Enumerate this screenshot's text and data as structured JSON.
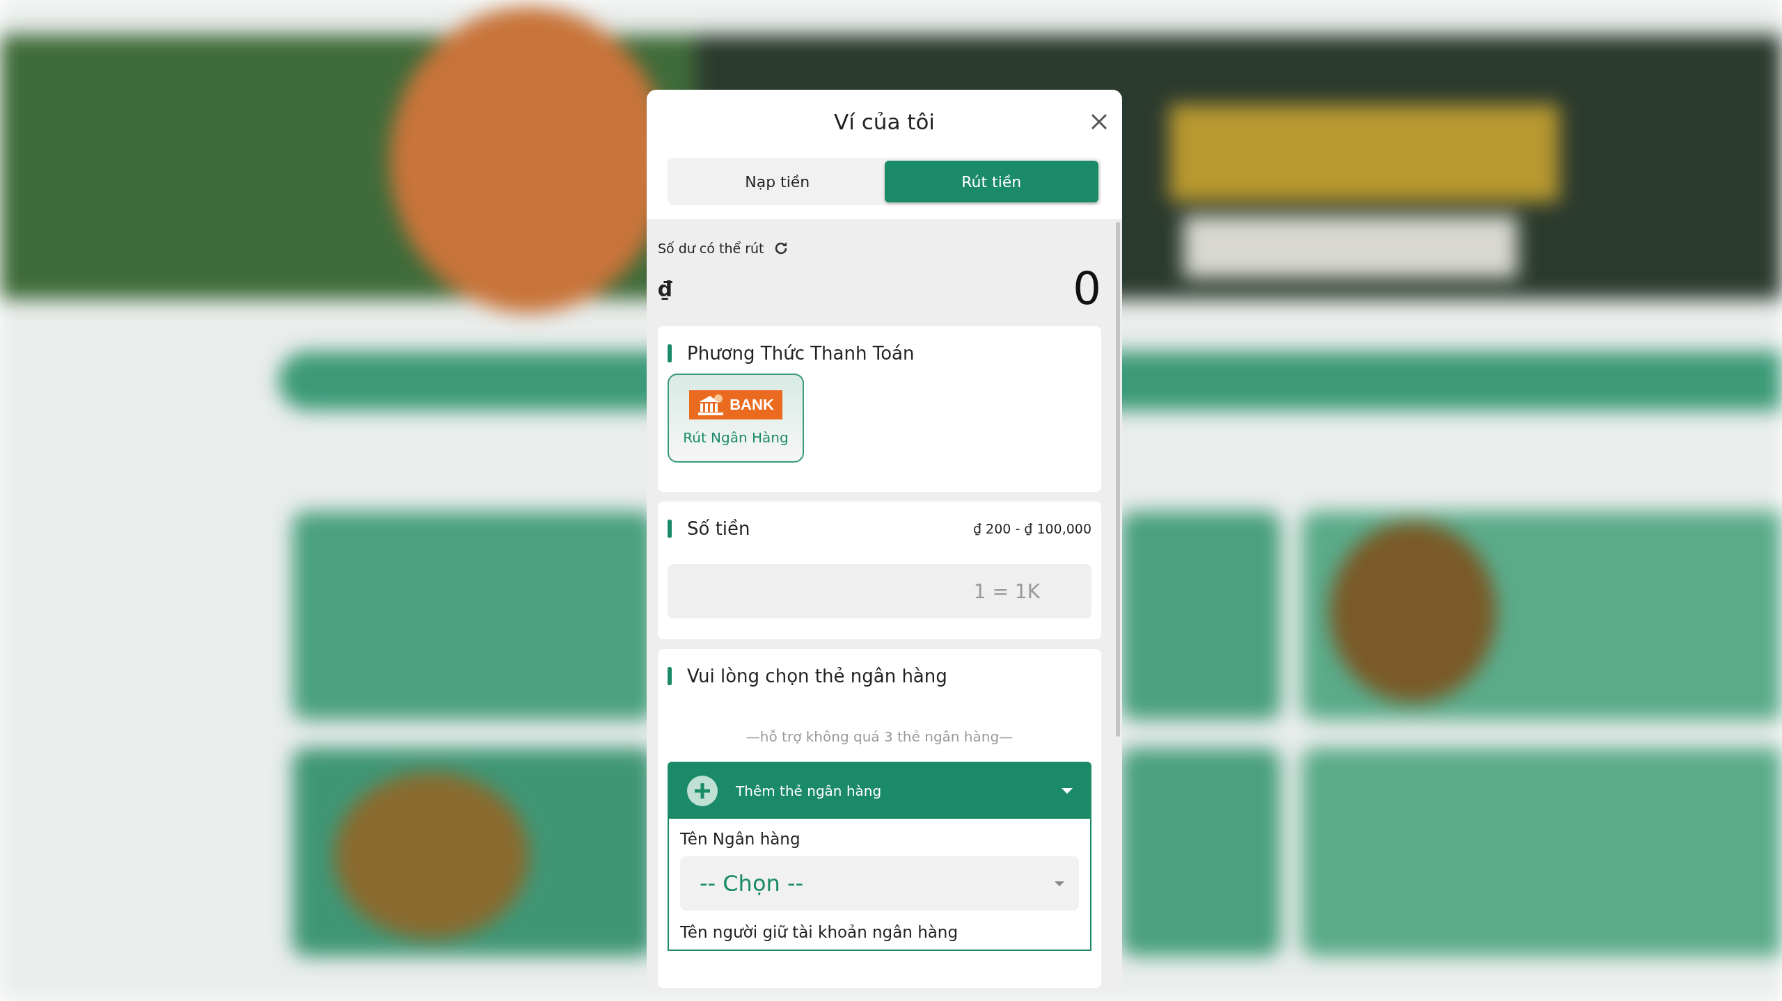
{
  "window": {
    "title": "Ví của tôi"
  },
  "tabs": [
    {
      "label": "Nạp tiền",
      "selected": false
    },
    {
      "label": "Rút tiền",
      "selected": true
    }
  ],
  "balance": {
    "label": "Số dư có thể rút",
    "currency": "₫",
    "amount": "0"
  },
  "payment_method": {
    "title": "Phương Thức Thanh Toán",
    "options": [
      {
        "logo_text": "BANK",
        "label": "Rút Ngân Hàng",
        "selected": true
      }
    ]
  },
  "amount": {
    "title": "Số tiền",
    "range": "₫ 200 - ₫ 100,000",
    "placeholder": "1 = 1K"
  },
  "bank_card": {
    "title": "Vui lòng chọn thẻ ngân hàng",
    "hint": "—hỗ trợ không quá 3 thẻ ngân hàng—",
    "add_card": {
      "label": "Thêm thẻ ngân hàng",
      "expanded": true
    },
    "fields": [
      {
        "label": "Tên Ngân hàng",
        "kind": "select",
        "value": "-- Chọn --"
      },
      {
        "label": "Tên người giữ tài khoản ngân hàng",
        "kind": "label"
      }
    ]
  }
}
